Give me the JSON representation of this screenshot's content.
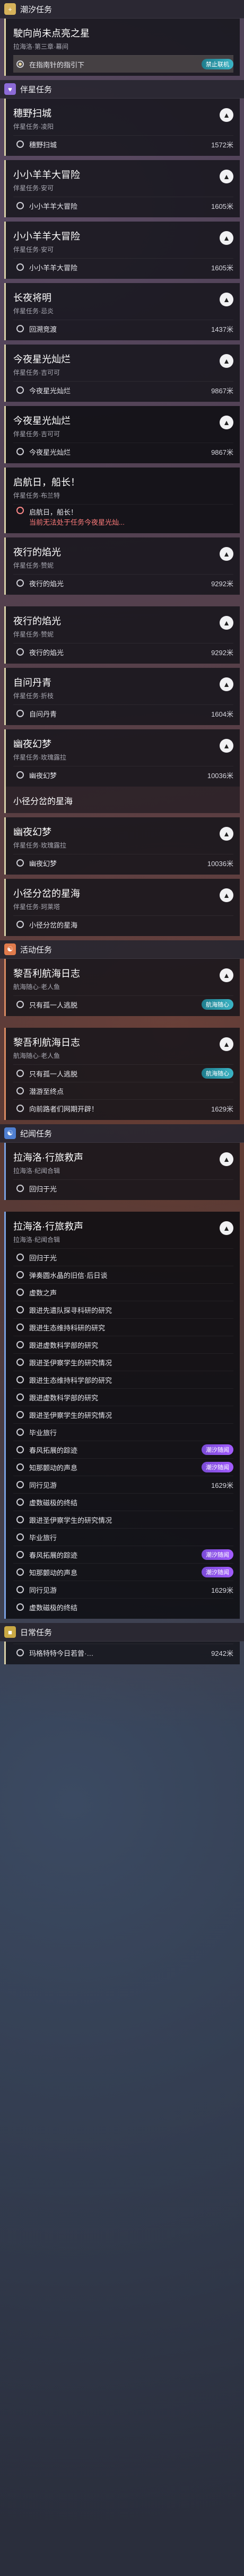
{
  "sections": {
    "tide": {
      "icon": "+",
      "title": "潮汐任务"
    },
    "companion": {
      "icon": "♥",
      "title": "伴星任务"
    },
    "activity": {
      "icon": "☯",
      "title": "活动任务"
    },
    "chronicle": {
      "icon": "☯",
      "title": "纪闻任务"
    },
    "daily": {
      "icon": "■",
      "title": "日常任务"
    }
  },
  "cards": [
    {
      "title": "駛向尚未点亮之星",
      "sub": "拉海洛·第三章·幕间",
      "objectives": [
        {
          "text": "在指南针的指引下",
          "badge": "禁止联机",
          "badge_style": "teal"
        }
      ]
    },
    {
      "title": "穗野扫城",
      "sub": "伴星任务·凌阳",
      "objectives": [
        {
          "text": "穗野扫城",
          "dist": "1572米"
        }
      ]
    },
    {
      "title": "小小羊羊大冒险",
      "sub": "伴星任务·安可",
      "objectives": [
        {
          "text": "小小羊羊大冒险",
          "dist": "1605米"
        }
      ]
    },
    {
      "title": "小小羊羊大冒险",
      "sub": "伴星任务·安可",
      "objectives": [
        {
          "text": "小小羊羊大冒险",
          "dist": "1605米"
        }
      ]
    },
    {
      "title": "长夜将明",
      "sub": "伴星任务·忌炎",
      "objectives": [
        {
          "text": "回溯竞渡",
          "dist": "1437米"
        }
      ]
    },
    {
      "title": "今夜星光灿烂",
      "sub": "伴星任务·吉可可",
      "objectives": [
        {
          "text": "今夜星光灿烂",
          "dist": "9867米"
        }
      ]
    },
    {
      "title": "今夜星光灿烂",
      "sub": "伴星任务·吉可可",
      "objectives": [
        {
          "text": "今夜星光灿烂",
          "dist": "9867米"
        }
      ]
    },
    {
      "title": "启航日，船长！",
      "sub": "伴星任务·布兰特",
      "objectives": [
        {
          "text": "启航日，船长！",
          "warn": "当前无法处于任务今夜星光灿..."
        }
      ]
    },
    {
      "title": "夜行的焰光",
      "sub": "伴星任务·赞妮",
      "objectives": [
        {
          "text": "夜行的焰光",
          "dist": "9292米"
        }
      ]
    },
    {
      "title": "夜行的焰光",
      "sub": "伴星任务·赞妮",
      "objectives": [
        {
          "text": "夜行的焰光",
          "dist": "9292米"
        }
      ]
    },
    {
      "title": "自问丹青",
      "sub": "伴星任务·折枝",
      "objectives": [
        {
          "text": "自问丹青",
          "dist": "1604米"
        }
      ]
    },
    {
      "title": "幽夜幻梦",
      "sub": "伴星任务·玫瑰露拉",
      "objectives": [
        {
          "text": "幽夜幻梦",
          "dist": "10036米"
        }
      ]
    },
    {
      "title": "小径分岔的星海",
      "sub": "",
      "objectives": []
    },
    {
      "title": "幽夜幻梦",
      "sub": "伴星任务·玫瑰露拉",
      "objectives": [
        {
          "text": "幽夜幻梦",
          "dist": "10036米"
        }
      ]
    },
    {
      "title": "小径分岔的星海",
      "sub": "伴星任务·珂莱塔",
      "objectives": [
        {
          "text": "小径分岔的星海"
        }
      ]
    },
    {
      "title": "黎吾利航海日志",
      "sub": "航海随心·老人鱼",
      "objectives": [
        {
          "text": "只有孤一人逃脱",
          "badge": "航海随心",
          "badge_style": "teal"
        }
      ]
    },
    {
      "title": "黎吾利航海日志",
      "sub": "航海随心·老人鱼",
      "objectives": [
        {
          "text": "只有孤一人逃脱",
          "badge": "航海随心",
          "badge_style": "teal"
        },
        {
          "text": "潜游至终点"
        },
        {
          "text": "向前路者们网期开辟！",
          "dist": "1629米"
        }
      ]
    },
    {
      "title": "拉海洛·行旅救声",
      "sub": "拉海洛·纪闻合辑",
      "objectives": [
        {
          "text": "回归于光"
        }
      ]
    },
    {
      "title": "拉海洛·行旅救声",
      "sub": "拉海洛·纪闻合辑",
      "objectives": [
        {
          "text": "回归于光"
        },
        {
          "text": "弹奏圆水晶的旧信·后日谈"
        },
        {
          "text": "虚数之声"
        },
        {
          "text": "跟进先遣队探寻科研的研究"
        },
        {
          "text": "跟进生态维持科研的研究"
        },
        {
          "text": "跟进虚数科学部的研究"
        },
        {
          "text": "跟进圣伊察学生的研究情况"
        },
        {
          "text": "跟进生态维持科学部的研究"
        },
        {
          "text": "跟进虚数科学部的研究"
        },
        {
          "text": "跟进圣伊察学生的研究情况"
        },
        {
          "text": "毕业旅行"
        },
        {
          "text": "春风拓展的踪迹",
          "badge": "潮汐随闻",
          "badge_style": "purple"
        },
        {
          "text": "知那颤动的声息",
          "badge": "潮汐随闻",
          "badge_style": "purple"
        },
        {
          "text": "同行见游",
          "dist": "1629米"
        },
        {
          "text": "虚数磁极的终结"
        },
        {
          "text": "跟进圣伊察学生的研究情况"
        },
        {
          "text": "毕业旅行"
        },
        {
          "text": "春风拓展的踪迹",
          "badge": "潮汐随闻",
          "badge_style": "purple"
        },
        {
          "text": "知那颤动的声息",
          "badge": "潮汐随闻",
          "badge_style": "purple"
        },
        {
          "text": "同行见游",
          "dist": "1629米"
        },
        {
          "text": "虚数磁极的终结"
        }
      ]
    },
    {
      "title": "日常任务",
      "sub": "",
      "objectives": [
        {
          "text": "玛格特特今日若曾·…",
          "dist": "9242米"
        }
      ]
    }
  ]
}
